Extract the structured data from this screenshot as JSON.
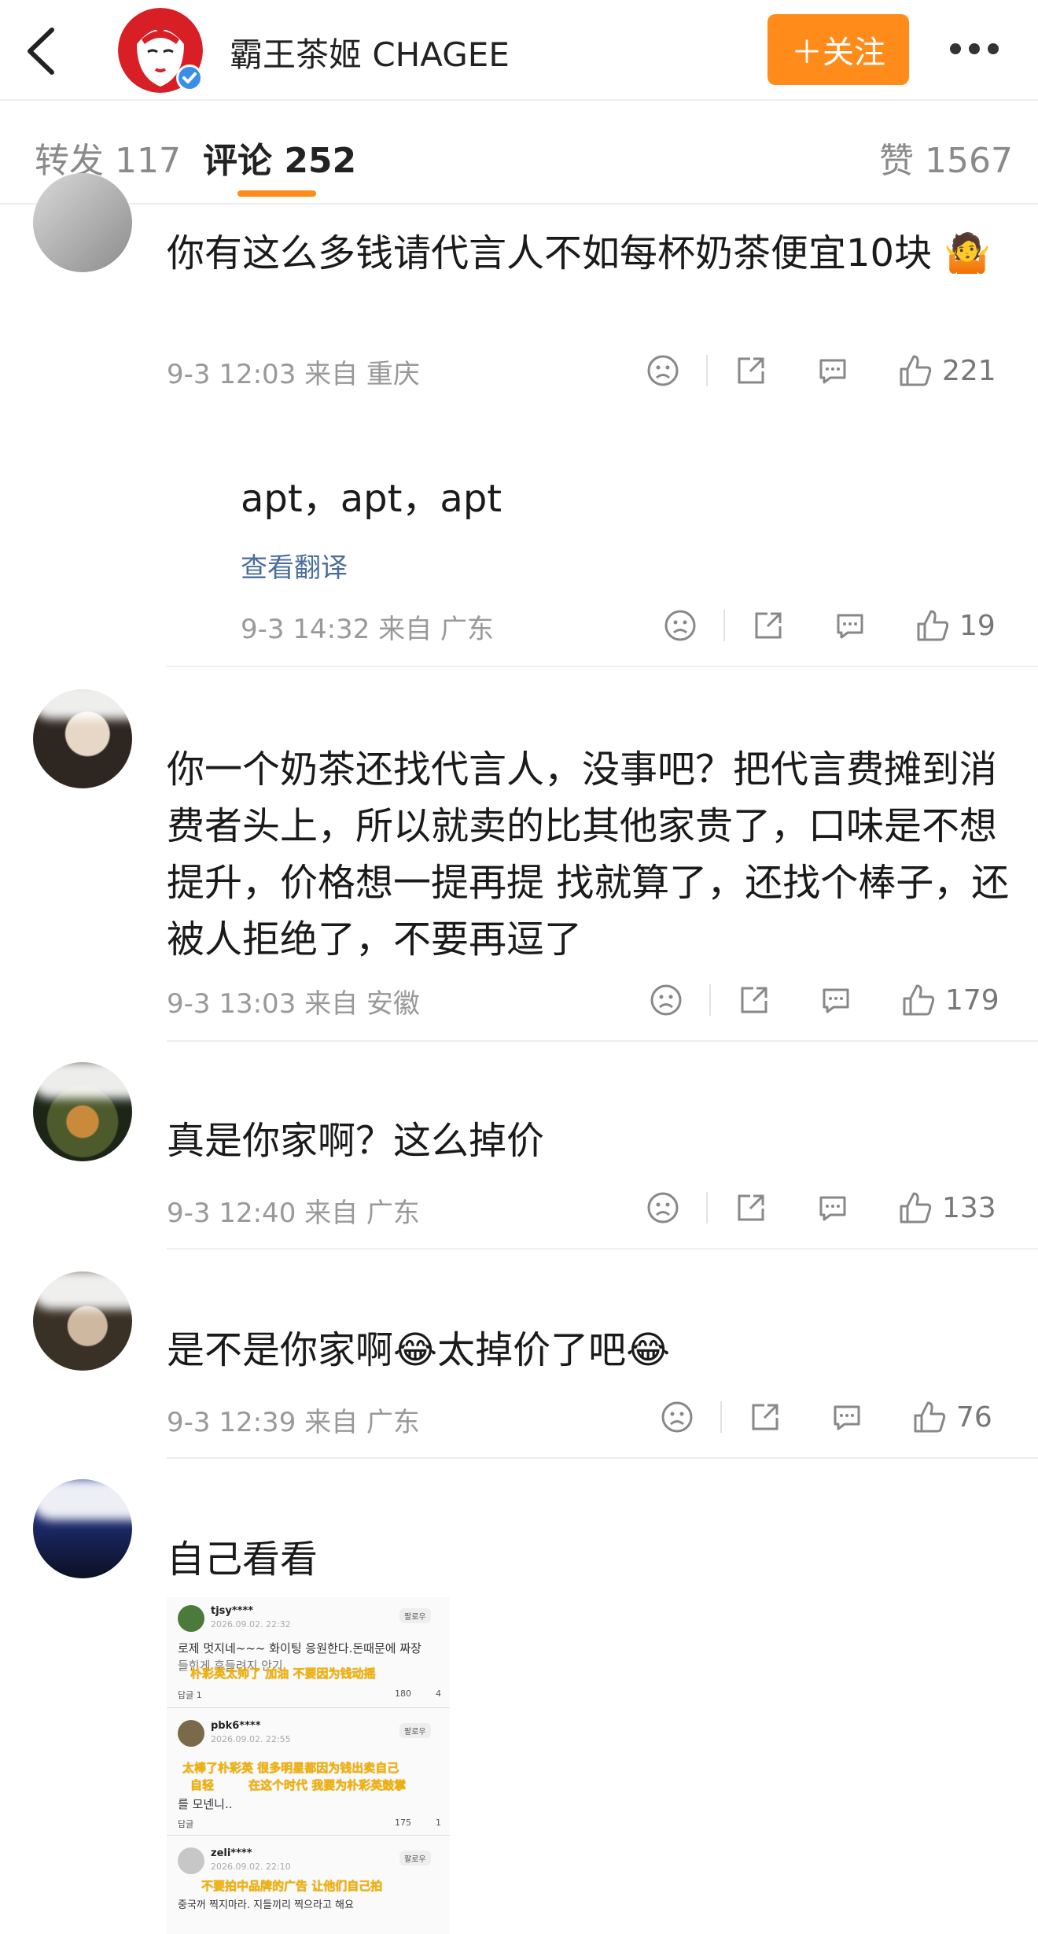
{
  "header": {
    "brand_name": "霸王茶姬 CHAGEE",
    "follow_label": "＋关注"
  },
  "tabs": {
    "repost": "转发 117",
    "comments": "评论 252",
    "likes": "赞 1567"
  },
  "colors": {
    "accent": "#ff8c1a",
    "verified": "#3b8ee8",
    "link": "#4a6e9a"
  },
  "comments": [
    {
      "text": "你有这么多钱请代言人不如每杯奶茶便宜10块 🤷",
      "meta": "9-3 12:03  来自 重庆",
      "likes": "221"
    },
    {
      "text": "apt，apt，apt",
      "translate": "查看翻译",
      "meta": "9-3 14:32  来自 广东",
      "likes": "19"
    },
    {
      "text": "你一个奶茶还找代言人，没事吧？把代言费摊到消费者头上，所以就卖的比其他家贵了，口味是不想提升，价格想一提再提 找就算了，还找个棒子，还被人拒绝了，不要再逗了",
      "meta": "9-3 13:03  来自 安徽",
      "likes": "179"
    },
    {
      "text": "真是你家啊？这么掉价",
      "meta": "9-3 12:40  来自 广东",
      "likes": "133"
    },
    {
      "text": "是不是你家啊😂太掉价了吧😂",
      "meta": "9-3 12:39  来自 广东",
      "likes": "76"
    },
    {
      "text": "自己看看"
    }
  ],
  "embedded_screenshot": {
    "entries": [
      {
        "user": "tjsy****",
        "date": "2026.09.02. 22:32",
        "text": "로제 멋지네~~~ 화이팅 응원한다.돈때문에 짜장",
        "text2": "들힌게 후들려지 안기",
        "caption": "朴彩英太帅了 加油 不要因为钱动摇",
        "reply": "답글 1",
        "likes": "180",
        "dislikes": "4",
        "follow": "팔로우"
      },
      {
        "user": "pbk6****",
        "date": "2026.09.02. 22:55",
        "caption": "太棒了朴彩英 很多明星都因为钱出卖自己",
        "caption2": "自轻",
        "caption3": "在这个时代 我要为朴彩英鼓掌",
        "text": "를 모넨니..",
        "reply": "답글",
        "likes": "175",
        "dislikes": "1",
        "follow": "팔로우"
      },
      {
        "user": "zeli****",
        "date": "2026.09.02. 22:10",
        "caption": "不要拍中品牌的广告 让他们自己拍",
        "text": "중국꺼 찍지마라. 지들끼리 찍으라고 해요",
        "follow": "팔로우"
      }
    ]
  }
}
